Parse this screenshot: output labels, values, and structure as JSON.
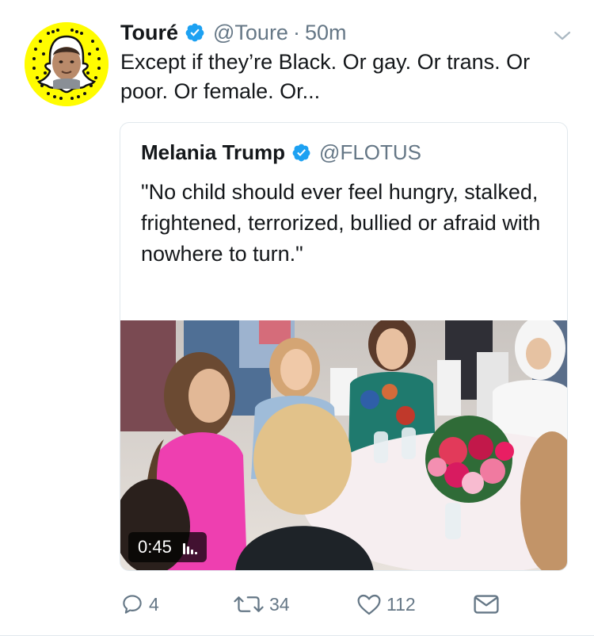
{
  "tweet": {
    "author_name": "Touré",
    "author_handle": "@Toure",
    "separator": "·",
    "time": "50m",
    "text": "Except if they’re Black. Or gay. Or trans. Or poor. Or female. Or..."
  },
  "quoted_tweet": {
    "author_name": "Melania Trump",
    "author_handle": "@FLOTUS",
    "text": "\"No child should ever feel hungry, stalked, frightened, terrorized, bullied or afraid with nowhere to turn.\"",
    "video_duration": "0:45"
  },
  "actions": {
    "reply_count": "4",
    "retweet_count": "34",
    "like_count": "112"
  },
  "colors": {
    "verified": "#1da1f2",
    "secondary_text": "#657786",
    "avatar_background": "#fffc00"
  },
  "icons": [
    "snapcode-avatar",
    "verified-icon",
    "chevron-down-icon",
    "reply-icon",
    "retweet-icon",
    "like-icon",
    "message-icon",
    "volume-icon"
  ]
}
